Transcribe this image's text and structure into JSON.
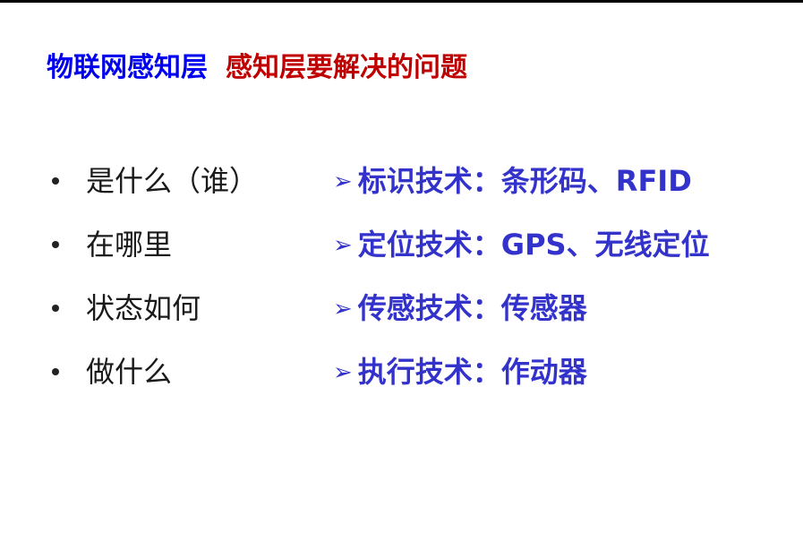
{
  "slide": {
    "title_part1": "物联网感知层",
    "title_part2": "感知层要解决的问题",
    "rows": [
      {
        "question": "是什么（谁）",
        "answer": "标识技术：条形码、RFID"
      },
      {
        "question": "在哪里",
        "answer": "定位技术：GPS、无线定位"
      },
      {
        "question": "状态如何",
        "answer": "传感技术：传感器"
      },
      {
        "question": "做什么",
        "answer": "执行技术：作动器"
      }
    ],
    "arrow_glyph": "➢"
  },
  "colors": {
    "title_blue": "#0000ee",
    "title_red": "#c00000",
    "answer_blue": "#3333cc",
    "text": "#1a1a1a"
  }
}
